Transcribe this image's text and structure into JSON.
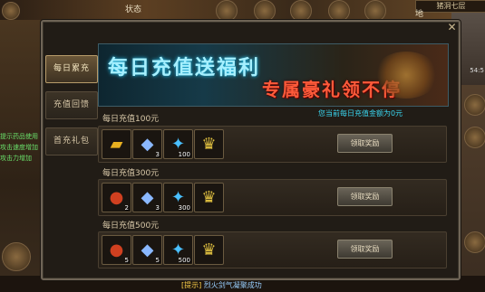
{
  "hud": {
    "top_left_text": "状态",
    "map_name": "猪洞七层",
    "map_button": "地",
    "time": "54:5",
    "chat_lines": [
      "提示药品使用",
      "攻击速度增加",
      "攻击力增加"
    ],
    "bottom_message_tag": "[提示]",
    "bottom_message": "烈火剑气凝聚成功"
  },
  "dialog": {
    "tabs": [
      {
        "label": "每日累充",
        "active": true
      },
      {
        "label": "充值回馈",
        "active": false
      },
      {
        "label": "首充礼包",
        "active": false
      }
    ],
    "banner": {
      "title": "每日充值送福利",
      "subtitle": "专属豪礼领不停"
    },
    "recharge_label": "您当前每日充值金额为",
    "recharge_amount": "0元",
    "tiers": [
      {
        "label": "每日充值100元",
        "button": "领取奖励",
        "items": [
          {
            "icon": "gold-ingot-icon",
            "qty": ""
          },
          {
            "icon": "blue-crystal-icon",
            "qty": "3"
          },
          {
            "icon": "blue-star-icon",
            "qty": "100"
          },
          {
            "icon": "gold-crown-icon",
            "qty": ""
          }
        ]
      },
      {
        "label": "每日充值300元",
        "button": "领取奖励",
        "items": [
          {
            "icon": "red-ore-icon",
            "qty": "2"
          },
          {
            "icon": "blue-crystal-icon",
            "qty": "3"
          },
          {
            "icon": "blue-star-icon",
            "qty": "300"
          },
          {
            "icon": "gold-crown-icon",
            "qty": ""
          }
        ]
      },
      {
        "label": "每日充值500元",
        "button": "领取奖励",
        "items": [
          {
            "icon": "red-ore-icon",
            "qty": "5"
          },
          {
            "icon": "blue-crystal-icon",
            "qty": "5"
          },
          {
            "icon": "blue-star-icon",
            "qty": "500"
          },
          {
            "icon": "gold-crown-icon",
            "qty": ""
          }
        ]
      }
    ]
  },
  "colors": {
    "accent_cyan": "#3ad6f0",
    "banner_red": "#ff5a3a",
    "panel_bg": "#211c16"
  }
}
